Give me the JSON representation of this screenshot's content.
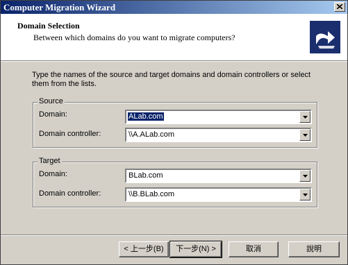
{
  "window": {
    "title": "Computer Migration Wizard"
  },
  "header": {
    "title": "Domain Selection",
    "subtitle": "Between which domains do you want to migrate computers?",
    "icon": "wizard-arrow-icon"
  },
  "instructions": "Type the names of the source and target domains and domain controllers or select them from the lists.",
  "source": {
    "legend": "Source",
    "domain_label": "Domain:",
    "domain_value": "ALab.com",
    "dc_label": "Domain controller:",
    "dc_value": "\\\\A.ALab.com"
  },
  "target": {
    "legend": "Target",
    "domain_label": "Domain:",
    "domain_value": "BLab.com",
    "dc_label": "Domain controller:",
    "dc_value": "\\\\B.BLab.com"
  },
  "buttons": {
    "back": "< 上一步(B)",
    "next": "下一步(N) >",
    "cancel": "取消",
    "help": "說明"
  },
  "colors": {
    "titlebar_start": "#0a246a",
    "titlebar_end": "#a6caf0",
    "face": "#d4d0c8"
  }
}
